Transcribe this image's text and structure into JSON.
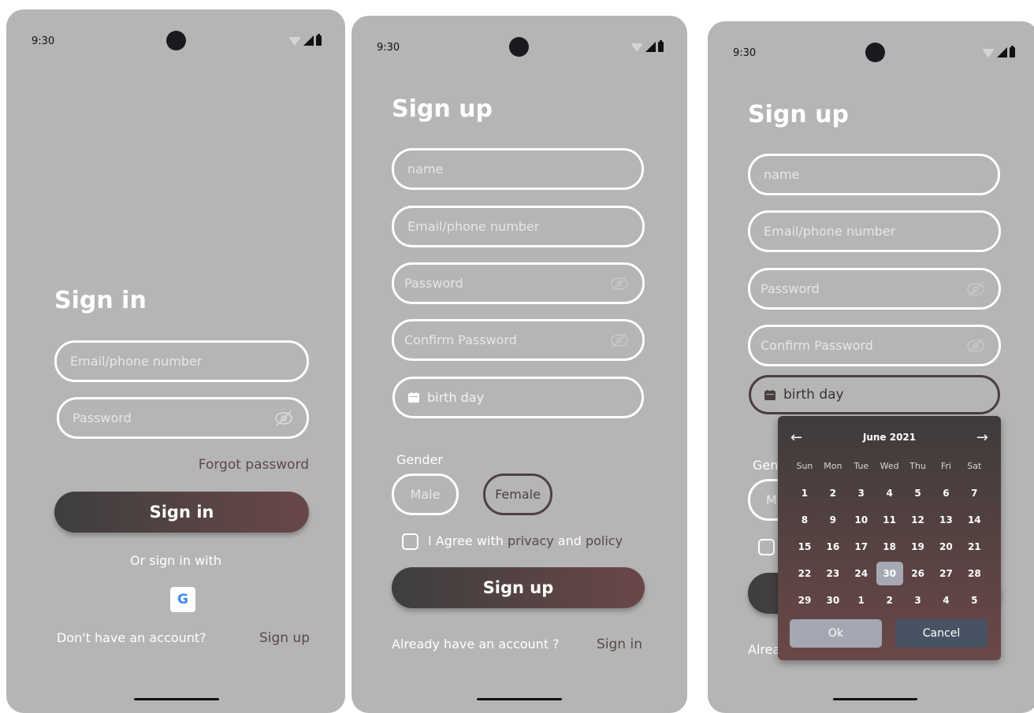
{
  "status": {
    "time": "9:30"
  },
  "signin": {
    "title": "Sign in",
    "email_placeholder": "Email/phone number",
    "password_placeholder": "Password",
    "forgot": "Forgot password",
    "button": "Sign in",
    "or_sign_in_with": "Or sign in with",
    "google_letter": "G",
    "no_account": "Don't have an account?",
    "sign_up_link": "Sign up"
  },
  "signup": {
    "title": "Sign up",
    "name_placeholder": "name",
    "email_placeholder": "Email/phone number",
    "password_placeholder": "Password",
    "confirm_placeholder": "Confirm Password",
    "birthday_placeholder": "birth day",
    "gender_label": "Gender",
    "male": "Male",
    "female": "Female",
    "agree_prefix": "I Agree with",
    "privacy": "privacy",
    "and": "and",
    "policy": "policy",
    "button": "Sign up",
    "have_account": "Already have an account ?",
    "sign_in_link": "Sign in"
  },
  "signup_picker": {
    "title": "Sign up",
    "name_placeholder": "name",
    "email_placeholder": "Email/phone number",
    "password_placeholder": "Password",
    "confirm_placeholder": "Confirm Password",
    "birthday_value": "birth day",
    "gender_partial": "Gen",
    "male_partial": "M",
    "have_account_partial": "Alrea",
    "picker": {
      "prev": "←",
      "next": "→",
      "month": "June 2021",
      "weekdays": [
        "Sun",
        "Mon",
        "Tue",
        "Wed",
        "Thu",
        "Fri",
        "Sat"
      ],
      "weeks": [
        [
          "1",
          "2",
          "3",
          "4",
          "5",
          "6",
          "7"
        ],
        [
          "8",
          "9",
          "10",
          "11",
          "12",
          "13",
          "14"
        ],
        [
          "15",
          "16",
          "17",
          "18",
          "19",
          "20",
          "21"
        ],
        [
          "22",
          "23",
          "24",
          "30",
          "26",
          "27",
          "28"
        ],
        [
          "29",
          "30",
          "1",
          "2",
          "3",
          "4",
          "5"
        ]
      ],
      "selected": "30",
      "ok": "Ok",
      "cancel": "Cancel"
    }
  },
  "colors": {
    "phone_bg": "#b5b5b5",
    "accent_dark": "#3e3e3e",
    "accent_brown": "#6a4748",
    "link_brown": "#5a4848",
    "cancel_blue": "#475263"
  }
}
